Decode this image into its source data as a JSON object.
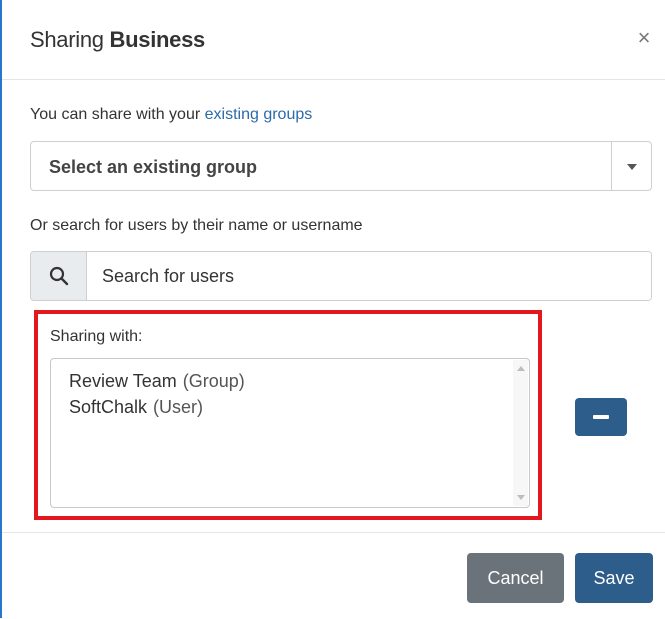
{
  "dialog": {
    "title_prefix": "Sharing",
    "title_name": "Business",
    "close_glyph": "×"
  },
  "groups": {
    "intro_text": "You can share with your ",
    "intro_link": "existing groups",
    "select_value": "Select an existing group"
  },
  "users": {
    "intro_text": "Or search for users by their name or username",
    "search_placeholder": "Search for users"
  },
  "sharing": {
    "label": "Sharing with:",
    "items": [
      {
        "name": "Review Team",
        "kind": "(Group)"
      },
      {
        "name": "SoftChalk",
        "kind": "(User)"
      }
    ]
  },
  "footer": {
    "cancel_label": "Cancel",
    "save_label": "Save"
  },
  "colors": {
    "primary": "#2d5d8a",
    "secondary": "#6b737a",
    "highlight": "#e3181f",
    "link": "#2c6aa8"
  },
  "icons": [
    "close-icon",
    "search-icon",
    "caret-down-icon",
    "minus-icon",
    "scroll-up-icon",
    "scroll-down-icon"
  ]
}
